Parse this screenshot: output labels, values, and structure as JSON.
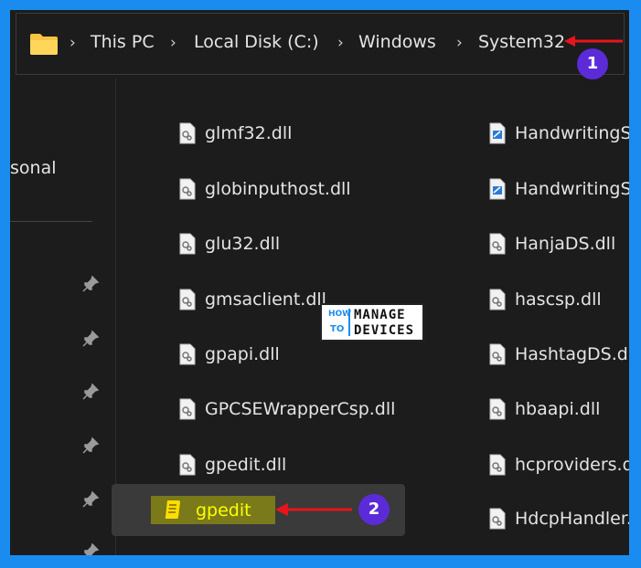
{
  "breadcrumb": [
    "This PC",
    "Local Disk (C:)",
    "Windows",
    "System32"
  ],
  "sidebar": {
    "partial_label": "sonal"
  },
  "files_col1": [
    "glmf32.dll",
    "globinputhost.dll",
    "glu32.dll",
    "gmsaclient.dll",
    "gpapi.dll",
    "GPCSEWrapperCsp.dll",
    "gpedit.dll",
    "gpedit"
  ],
  "files_col2": [
    "HandwritingSy",
    "HandwritingSy",
    "HanjaDS.dll",
    "hascsp.dll",
    "HashtagDS.dll",
    "hbaapi.dll",
    "hcproviders.dl",
    "HdcpHandler."
  ],
  "annotations": {
    "step1": "1",
    "step2": "2",
    "color": "#e8141c",
    "badge_color": "#5b2bd8"
  },
  "logo": {
    "how": "HOW",
    "to": "TO",
    "manage": "MANAGE",
    "devices": "DEVICES"
  },
  "colors": {
    "frame": "#1a8cf0",
    "bg": "#1c1c1c",
    "selected": "#3a3a3a",
    "highlight": "#7a7a1a",
    "gpedit_text": "#ffff00"
  }
}
